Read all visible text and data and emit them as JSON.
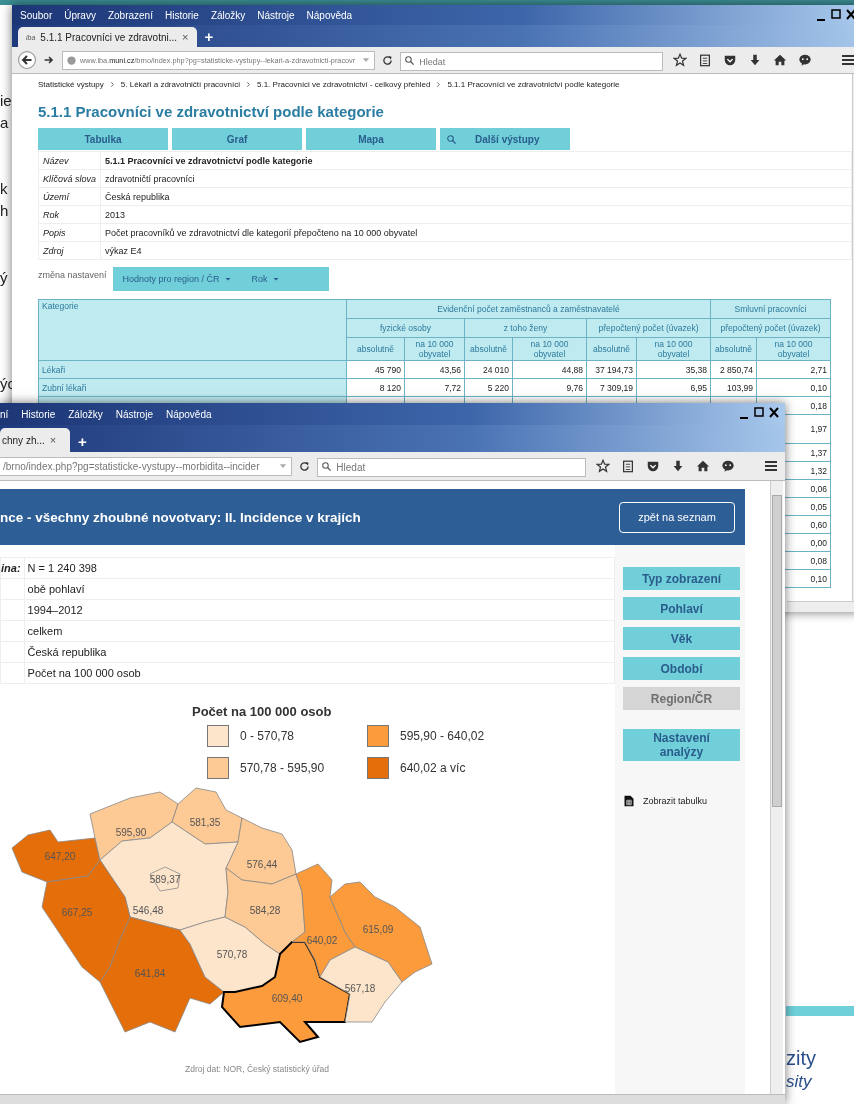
{
  "slide": {
    "left_fragments": [
      "ie",
      "a",
      "k",
      "h",
      "ý",
      "ýc"
    ],
    "bottom_right": [
      "zity",
      "sity"
    ]
  },
  "window_1": {
    "menu": [
      "Soubor",
      "Úpravy",
      "Zobrazení",
      "Historie",
      "Záložky",
      "Nástroje",
      "Nápověda"
    ],
    "tab": {
      "favicon_text": "iba",
      "title": "5.1.1 Pracovníci ve zdravotni...",
      "close": "×"
    },
    "new_tab": "+",
    "url": {
      "prefix": "www.iba.",
      "domain": "muni.cz",
      "path": "/brno/index.php?pg=statisticke-vystupy--lekari-a-zdravotnicti-pracovr"
    },
    "search": {
      "placeholder": "Hledat"
    },
    "breadcrumb": [
      "Statistické výstupy",
      "5. Lékaři a zdravotničtí pracovníci",
      "5.1. Pracovníci ve zdravotnictví - celkový přehled",
      "5.1.1 Pracovníci ve zdravotnictví podle kategorie"
    ],
    "title": "5.1.1 Pracovníci ve zdravotnictví podle kategorie",
    "view_buttons": [
      {
        "label": "Tabulka",
        "kind": "plain"
      },
      {
        "label": "Graf",
        "kind": "plain"
      },
      {
        "label": "Mapa",
        "kind": "plain"
      },
      {
        "label": "Další výstupy",
        "kind": "search"
      }
    ],
    "metadata": [
      {
        "label": "Název",
        "value": "5.1.1 Pracovníci ve zdravotnictví podle kategorie",
        "bold": true
      },
      {
        "label": "Klíčová slova",
        "value": "zdravotničtí pracovníci",
        "bold": false
      },
      {
        "label": "Území",
        "value": "Česká republika",
        "bold": false
      },
      {
        "label": "Rok",
        "value": "2013",
        "bold": false
      },
      {
        "label": "Popis",
        "value": "Počet pracovníků ve zdravotnictví dle kategorií přepočteno na 10 000 obyvatel",
        "bold": false
      },
      {
        "label": "Zdroj",
        "value": "výkaz E4",
        "bold": false
      }
    ],
    "settings": {
      "label": "změna nastavení",
      "dropdowns": [
        "Hodnoty pro region / ČR",
        "Rok"
      ]
    },
    "table": {
      "category_header": "Kategorie",
      "groups": [
        {
          "label": "Evidenční počet zaměstnanců a zaměstnavatelé",
          "subgroups": [
            {
              "label": "fyzické osoby",
              "columns": [
                "absolutně",
                "na 10 000 obyvatel"
              ]
            },
            {
              "label": "z toho ženy",
              "columns": [
                "absolutně",
                "na 10 000 obyvatel"
              ]
            },
            {
              "label": "přepočtený počet (úvazek)",
              "columns": [
                "absolutně",
                "na 10 000 obyvatel"
              ]
            }
          ]
        },
        {
          "label": "Smluvní pracovníci",
          "subgroups": [
            {
              "label": "přepočtený počet (úvazek)",
              "columns": [
                "absolutně",
                "na 10 000 obyvatel"
              ]
            }
          ]
        }
      ],
      "rows": [
        {
          "category": "Lékaři",
          "cells": [
            "45 790",
            "43,56",
            "24 010",
            "44,88",
            "37 194,73",
            "35,38",
            "2 850,74",
            "2,71"
          ]
        },
        {
          "category": "Zubní lékaři",
          "cells": [
            "8 120",
            "7,72",
            "5 220",
            "9,76",
            "7 309,19",
            "6,95",
            "103,99",
            "0,10"
          ]
        },
        {
          "cells": [
            "0,18"
          ]
        },
        {
          "cells": [
            "1,97"
          ]
        },
        {
          "cells": [
            "1,37"
          ]
        },
        {
          "cells": [
            "1,32"
          ]
        },
        {
          "cells": [
            "0,06"
          ]
        },
        {
          "cells": [
            "0,05"
          ]
        },
        {
          "cells": [
            "0,60"
          ]
        },
        {
          "cells": [
            "0,00"
          ]
        },
        {
          "cells": [
            "0,08"
          ]
        },
        {
          "cells": [
            "0,10"
          ]
        }
      ]
    }
  },
  "window_2": {
    "menu": [
      "ní",
      "Historie",
      "Záložky",
      "Nástroje",
      "Nápověda"
    ],
    "tab": {
      "title": "chny zh...",
      "close": "×"
    },
    "new_tab": "+",
    "url": {
      "path": "/brno/index.php?pg=statisticke-vystupy--morbidita--incider"
    },
    "search": {
      "placeholder": "Hledat"
    },
    "header": {
      "title": "nce - všechny zhoubné novotvary: II. Incidence v krajích",
      "back_button": "zpět na seznam"
    },
    "info": [
      {
        "label": "ina:",
        "value": "N = 1 240 398"
      },
      {
        "value": "obě pohlaví"
      },
      {
        "value": "1994–2012"
      },
      {
        "value": "celkem"
      },
      {
        "value": "Česká republika"
      },
      {
        "value": "Počet na 100 000 osob"
      }
    ],
    "legend": {
      "title": "Počet na 100 000 osob",
      "items": [
        {
          "label": "0 - 570,78",
          "color": "#fde5cc"
        },
        {
          "label": "570,78 - 595,90",
          "color": "#fdc995"
        },
        {
          "label": "595,90 - 640,02",
          "color": "#fb9b3c"
        },
        {
          "label": "640,02 a víc",
          "color": "#e46e0a"
        }
      ]
    },
    "map": {
      "regions": [
        {
          "label": "647,20",
          "color": "#e46e0a",
          "selected": false
        },
        {
          "label": "595,90",
          "color": "#fdc995",
          "selected": false
        },
        {
          "label": "581,35",
          "color": "#fdc995",
          "selected": false
        },
        {
          "label": "576,44",
          "color": "#fdc995",
          "selected": false
        },
        {
          "label": "546,48",
          "color": "#fde5cc",
          "selected": false
        },
        {
          "label": "589,37",
          "color": "#fde5cc",
          "selected": false
        },
        {
          "label": "667,25",
          "color": "#e46e0a",
          "selected": false
        },
        {
          "label": "641,84",
          "color": "#e46e0a",
          "selected": false
        },
        {
          "label": "570,78",
          "color": "#fde5cc",
          "selected": false
        },
        {
          "label": "584,28",
          "color": "#fdc995",
          "selected": false
        },
        {
          "label": "609,40",
          "color": "#fb9b3c",
          "selected": true
        },
        {
          "label": "640,02",
          "color": "#fb9b3c",
          "selected": false
        },
        {
          "label": "615,09",
          "color": "#fb9b3c",
          "selected": false
        },
        {
          "label": "567,18",
          "color": "#fde5cc",
          "selected": false
        }
      ]
    },
    "source": "Zdroj dat: NOR, Český statistický úřad",
    "sidebar": [
      {
        "label": "Typ zobrazení",
        "disabled": false
      },
      {
        "label": "Pohlaví",
        "disabled": false
      },
      {
        "label": "Věk",
        "disabled": false
      },
      {
        "label": "Období",
        "disabled": false
      },
      {
        "label": "Region/ČR",
        "disabled": true
      },
      {
        "label": "Nastavení analýzy",
        "disabled": false
      }
    ],
    "table_link": "Zobrazit tabulku"
  }
}
